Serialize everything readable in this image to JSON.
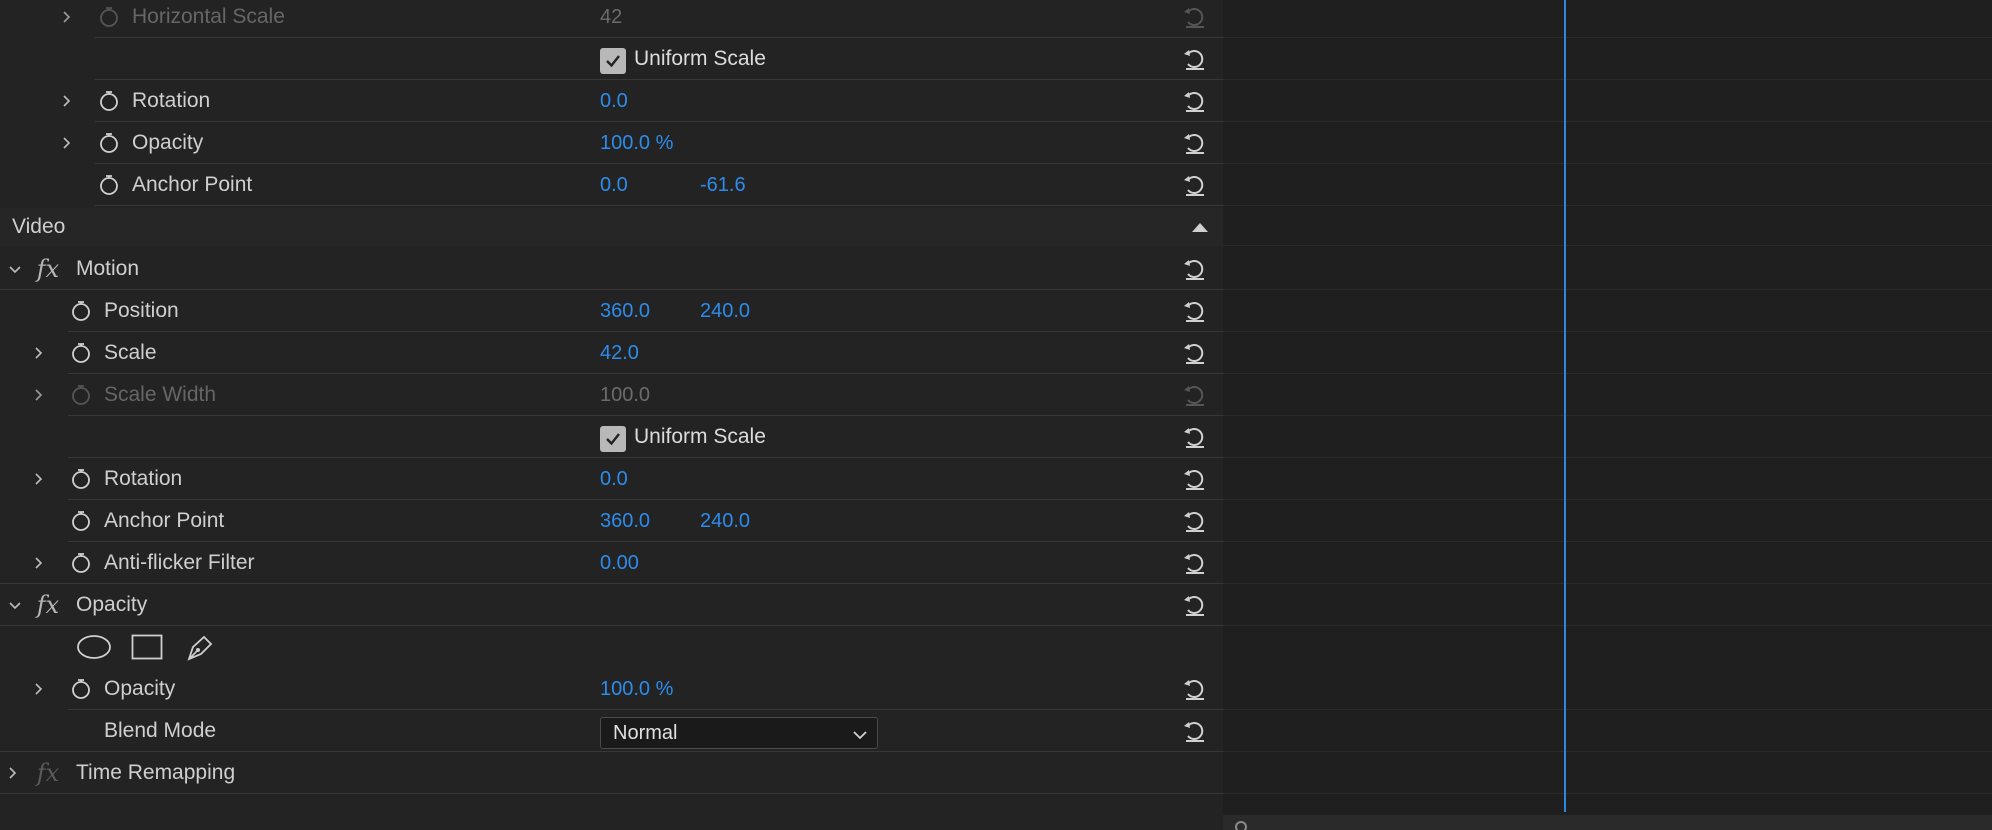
{
  "top_group": {
    "rows": [
      {
        "label": "Horizontal Scale",
        "values": [
          "42"
        ],
        "dim": true
      },
      {
        "checkbox_label": "Uniform Scale",
        "checked": true
      },
      {
        "label": "Rotation",
        "values": [
          "0.0"
        ]
      },
      {
        "label": "Opacity",
        "values": [
          "100.0 %"
        ]
      },
      {
        "label": "Anchor Point",
        "values": [
          "0.0",
          "-61.6"
        ]
      }
    ]
  },
  "video_section": {
    "title": "Video"
  },
  "motion": {
    "name": "Motion",
    "position": {
      "label": "Position",
      "x": "360.0",
      "y": "240.0"
    },
    "scale": {
      "label": "Scale",
      "value": "42.0"
    },
    "scale_width": {
      "label": "Scale Width",
      "value": "100.0"
    },
    "uniform_scale": {
      "label": "Uniform Scale",
      "checked": true
    },
    "rotation": {
      "label": "Rotation",
      "value": "0.0"
    },
    "anchor_point": {
      "label": "Anchor Point",
      "x": "360.0",
      "y": "240.0"
    },
    "anti_flicker": {
      "label": "Anti-flicker Filter",
      "value": "0.00"
    }
  },
  "opacity_effect": {
    "name": "Opacity",
    "mask_tools": [
      "ellipse-mask-icon",
      "rectangle-mask-icon",
      "pen-mask-icon"
    ],
    "opacity": {
      "label": "Opacity",
      "value": "100.0 %"
    },
    "blend_mode": {
      "label": "Blend Mode",
      "selected": "Normal"
    }
  },
  "time_remapping": {
    "name": "Time Remapping"
  },
  "colors": {
    "value_blue": "#2d8ceb",
    "playhead": "#2e86de"
  }
}
